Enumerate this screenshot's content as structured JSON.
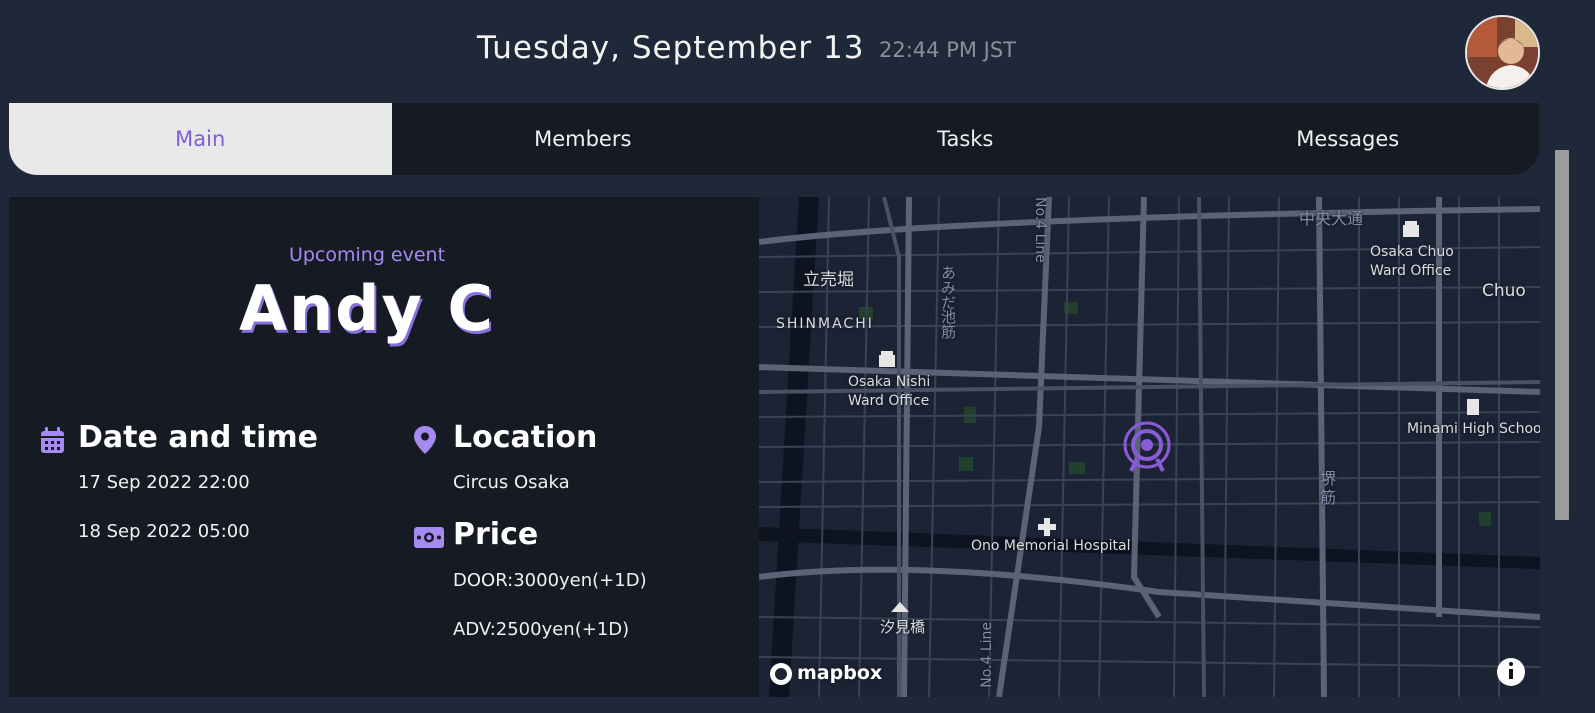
{
  "header": {
    "date": "Tuesday, September 13",
    "time": "22:44 PM JST"
  },
  "tabs": [
    {
      "label": "Main",
      "active": true
    },
    {
      "label": "Members",
      "active": false
    },
    {
      "label": "Tasks",
      "active": false
    },
    {
      "label": "Messages",
      "active": false
    }
  ],
  "event": {
    "kicker": "Upcoming event",
    "artist": "Andy C",
    "date_title": "Date and time",
    "start": "17 Sep 2022 22:00",
    "end": "18 Sep 2022 05:00",
    "location_title": "Location",
    "venue": "Circus Osaka",
    "price_title": "Price",
    "door_price": "DOOR:3000yen(+1D)",
    "adv_price": "ADV:2500yen(+1D)"
  },
  "map": {
    "labels": {
      "chuo_dori": "中央大通",
      "chuo_ward_office_1": "Osaka Chuo",
      "chuo_ward_office_2": "Ward Office",
      "tachiuribori": "立売堀",
      "shinmachi": "SHINMACHI",
      "amida_1": "あみだ",
      "amida_2": "池筋",
      "line_top": "No.4 Line",
      "nishi_ward_1": "Osaka Nishi",
      "nishi_ward_2": "Ward Office",
      "chuo": "Chuo",
      "minami_high": "Minami High Schoo",
      "sakaisuji_1": "堺",
      "sakaisuji_2": "筋",
      "hospital": "Ono Memorial Hospital",
      "shiomibashi": "汐見橋",
      "line_bottom": "No.4 Line",
      "attribution": "mapbox"
    },
    "colors": {
      "background": "#1c2334",
      "road": "#5a6475",
      "pin": "#8a5bd9"
    }
  },
  "colors": {
    "accent": "#a58af2",
    "page_bg": "#1f2839",
    "panel_bg": "#151a23"
  }
}
